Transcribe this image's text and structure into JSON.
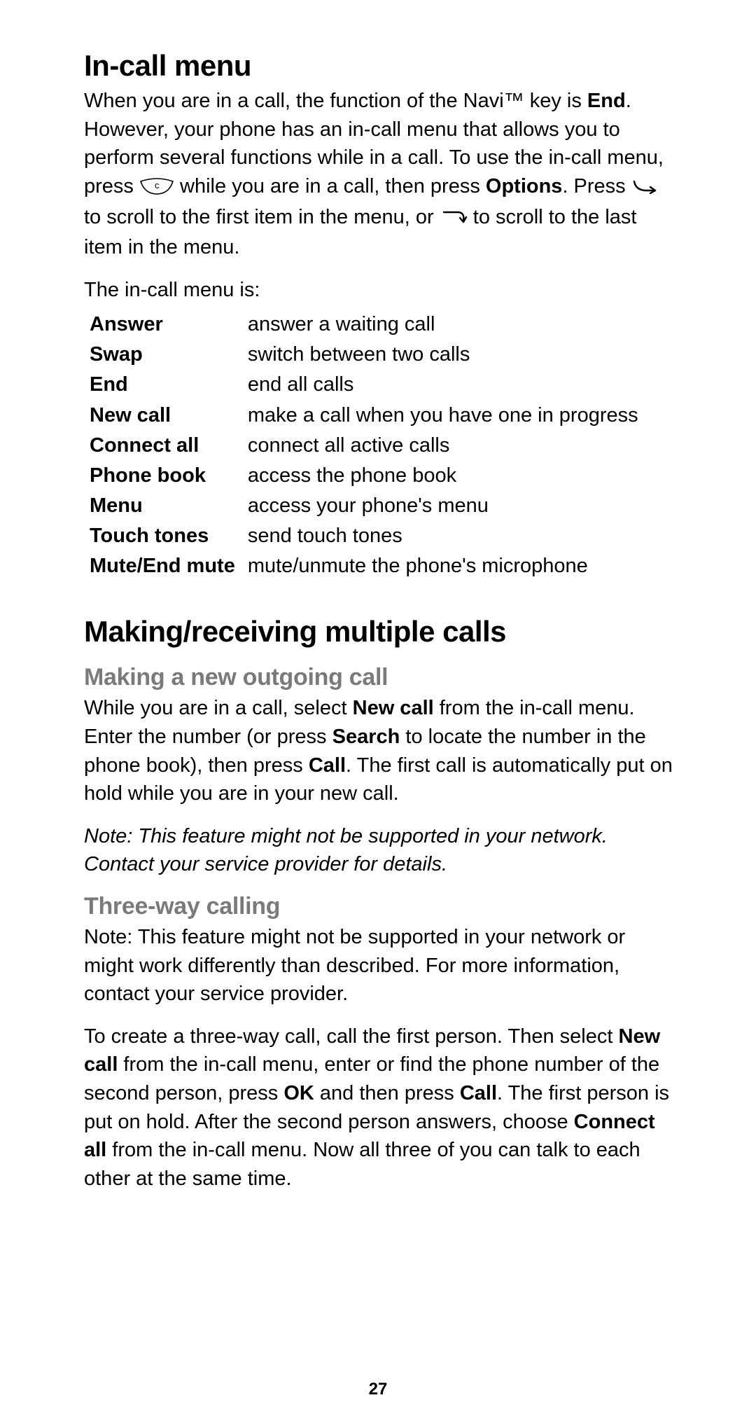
{
  "h1": "In-call menu",
  "intro": {
    "p1a": "When you are in a call, the  function of the Navi™ key  is ",
    "p1b_bold": "End",
    "p1c": ". However, your phone has an in-call menu that allows you to perform several functions while in a call. To use the in-call menu, press  ",
    "p1d": "  while you are in a call, then press ",
    "p1e_bold": "Options",
    "p1f": ". Press  ",
    "p1g": " to scroll to the first item in the menu, or ",
    "p1h": " to scroll to the last item in the menu."
  },
  "menu_intro": "The in-call menu is:",
  "menu": [
    {
      "term": "Answer",
      "desc": "answer a waiting call"
    },
    {
      "term": "Swap",
      "desc": "switch between two calls"
    },
    {
      "term": "End",
      "desc": "end all calls"
    },
    {
      "term": "New call",
      "desc": "make a call when you have one in progress"
    },
    {
      "term": "Connect all",
      "desc": "connect all active calls"
    },
    {
      "term": "Phone book",
      "desc": "access the phone book"
    },
    {
      "term": "Menu",
      "desc": "access your phone's menu"
    },
    {
      "term": "Touch tones",
      "desc": "send touch tones"
    },
    {
      "term": "Mute/End mute",
      "desc": "mute/unmute the phone's microphone"
    }
  ],
  "h2": "Making/receiving multiple calls",
  "h3a": "Making a new outgoing call",
  "outgoing": {
    "a": "While you are in a call, select ",
    "b": "New call",
    "c": " from the in-call menu. Enter the number (or press ",
    "d": "Search",
    "e": " to locate the number in the phone book), then press ",
    "f": "Call",
    "g": ". The first call is automatically put on hold while you are in your new call."
  },
  "note1": "Note:  This feature might not be supported in your network. Contact your service provider for details.",
  "h3b": "Three-way calling",
  "tw_note": "Note:  This feature might not be supported in your network or might work differently than described. For more information, contact your service provider.",
  "threeway": {
    "a": "To create a three-way call, call the first person. Then select ",
    "b": "New call",
    "c": " from the in-call menu, enter or find the phone number of the second person, press ",
    "d": "OK",
    "e": " and then press ",
    "f": "Call",
    "g": ". The first person is put on hold. After the second person answers, choose ",
    "h": "Connect all",
    "i": " from the in-call menu. Now all three of you can talk to each other at the same time."
  },
  "pagenum": "27"
}
